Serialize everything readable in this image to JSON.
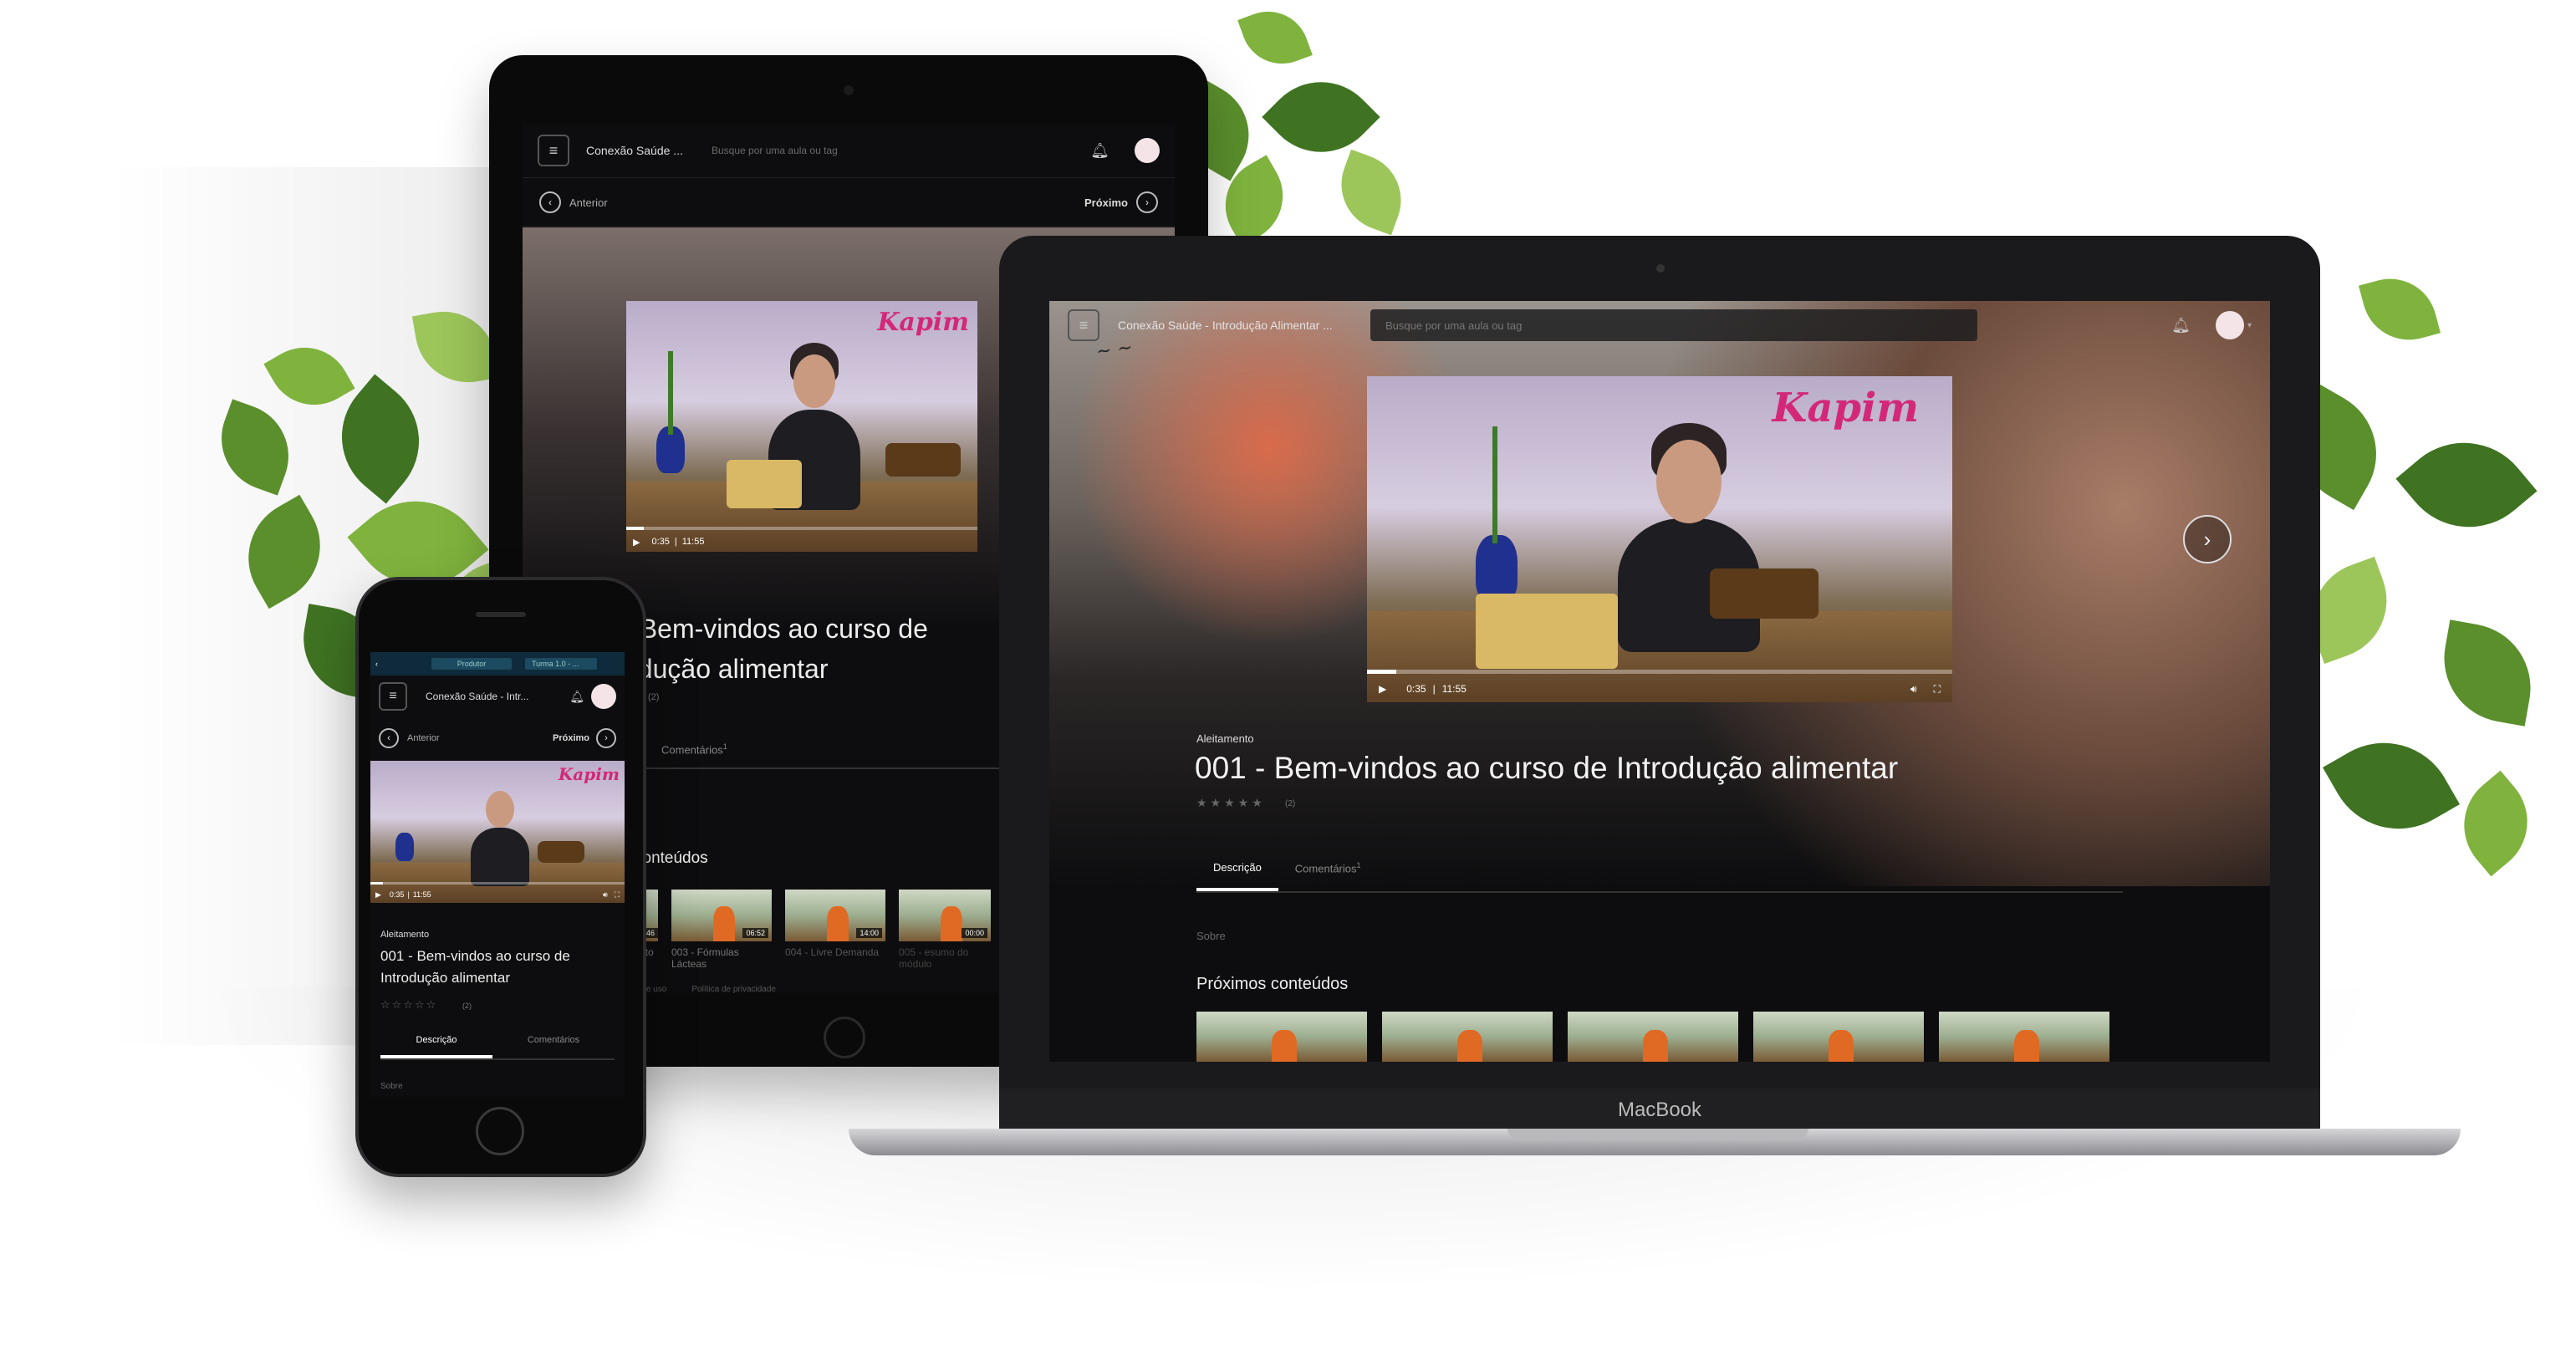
{
  "app": {
    "title_short": "Conexão Saúde ...",
    "title_long": "Conexão Saúde - Introdução Alimentar ...",
    "title_phone": "Conexão Saúde - Intr...",
    "search_placeholder": "Busque por uma aula ou tag"
  },
  "nav": {
    "prev": "Anterior",
    "next": "Próximo"
  },
  "phone_bar": {
    "producer": "Produtor",
    "class": "Turma 1.0 - ..."
  },
  "video": {
    "brand": "Kapim",
    "current": "0:35",
    "duration": "11:55"
  },
  "lesson": {
    "module": "Aleitamento",
    "title": "001 - Bem-vindos ao curso de Introdução alimentar",
    "title_tablet_line1": "001 - Bem-vindos ao curso de",
    "title_tablet_line2": "odução alimentar",
    "title_phone_line1": "001 - Bem-vindos ao curso de",
    "title_phone_line2": "Introdução alimentar",
    "stars": "★★★★★",
    "stars_outline": "☆☆☆☆☆",
    "rating_count": "(2)"
  },
  "tabs": {
    "description": "Descrição",
    "comments": "Comentários",
    "comments_count": "1"
  },
  "about": "Sobre",
  "next_section": "Próximos conteúdos",
  "next_section_tablet": "conteúdos",
  "tablet_thumbs": [
    {
      "duration": "3:46",
      "label": "nto"
    },
    {
      "duration": "06:52",
      "label": "003 - Fórmulas Lácteas"
    },
    {
      "duration": "14:00",
      "label": "004 - Livre Demanda"
    },
    {
      "duration": "00:00",
      "label": "005 - esumo do módulo"
    }
  ],
  "tablet_footer": {
    "terms": "o de uso",
    "privacy": "Política de privacidade"
  },
  "laptop_brand": "MacBook",
  "colors": {
    "screen_bg": "#0d0d0f",
    "brand_pink": "#d3287a",
    "leaf_green": "#5a8f2c"
  }
}
